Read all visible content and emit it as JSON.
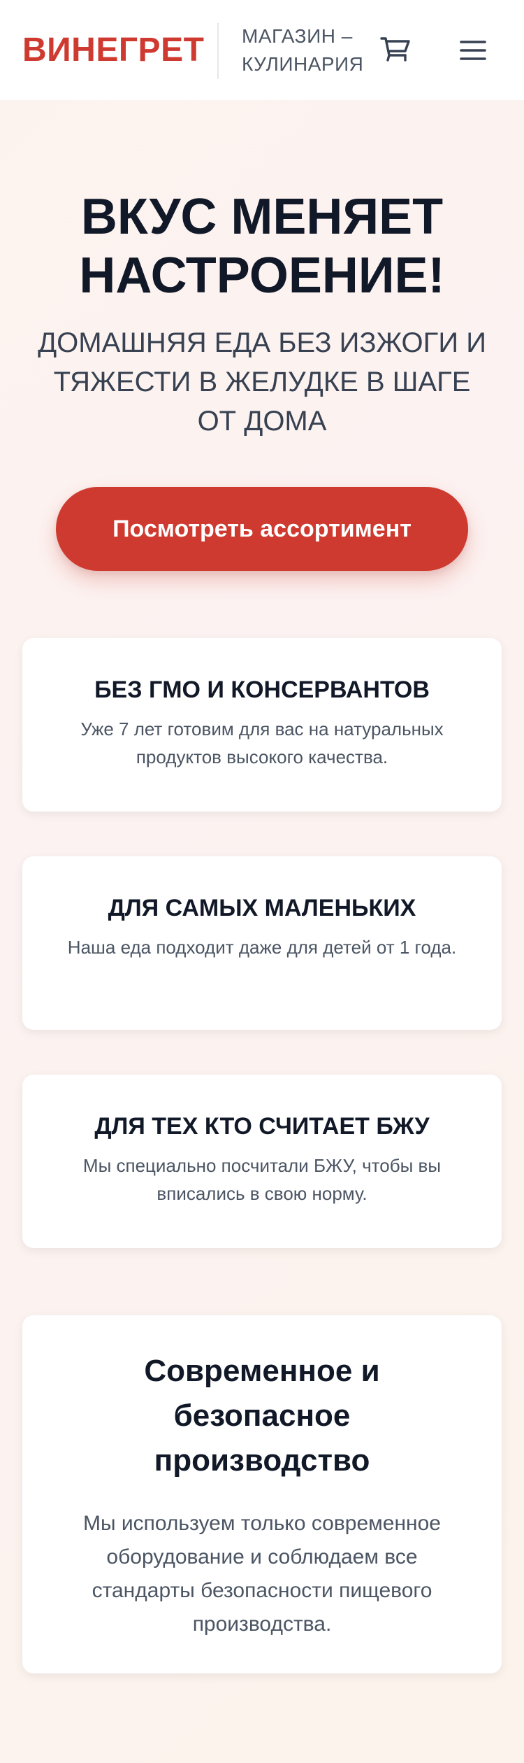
{
  "header": {
    "logo": "ВИНЕГРЕТ",
    "tagline_line1": "МАГАЗИН –",
    "tagline_line2": "КУЛИНАРИЯ",
    "cart_icon": "cart-icon",
    "menu_icon": "hamburger-menu-icon"
  },
  "hero": {
    "title_line1": "ВКУС МЕНЯЕТ",
    "title_line2": "НАСТРОЕНИЕ!",
    "subtitle": "ДОМАШНЯЯ ЕДА БЕЗ ИЗЖОГИ И ТЯЖЕСТИ В ЖЕЛУДКЕ В ШАГЕ ОТ ДОМА",
    "cta_label": "Посмотреть ассортимент"
  },
  "features": [
    {
      "title": "БЕЗ ГМО И КОНСЕРВАНТОВ",
      "text": "Уже 7 лет готовим для вас на натуральных продуктов высокого качества."
    },
    {
      "title": "ДЛЯ САМЫХ МАЛЕНЬКИХ",
      "text": "Наша еда подходит даже для детей от 1 года."
    },
    {
      "title": "ДЛЯ ТЕХ КТО СЧИТАЕТ БЖУ",
      "text": "Мы специально посчитали БЖУ, чтобы вы вписались в свою норму."
    }
  ],
  "production": {
    "title": "Современное и безопасное производство",
    "text": "Мы используем только современное оборудование и соблюдаем все стандарты безопасности пищевого производства."
  },
  "colors": {
    "brand_red": "#cf3a30",
    "text_dark": "#111827",
    "text_muted": "#4b5563"
  }
}
